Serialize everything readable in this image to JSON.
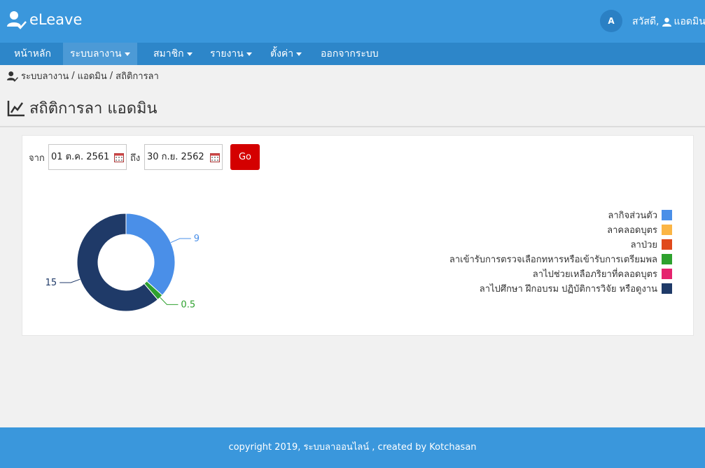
{
  "app": {
    "brand": "eLeave",
    "lang_button": "A",
    "greeting": "สวัสดี,",
    "user_name": "แอดมิน"
  },
  "menu": [
    {
      "label": "หน้าหลัก",
      "caret": false,
      "active": false
    },
    {
      "label": "ระบบลางาน",
      "caret": true,
      "active": true
    },
    {
      "label": "สมาชิก",
      "caret": true,
      "active": false
    },
    {
      "label": "รายงาน",
      "caret": true,
      "active": false
    },
    {
      "label": "ตั้งค่า",
      "caret": true,
      "active": false
    },
    {
      "label": "ออกจากระบบ",
      "caret": false,
      "active": false
    }
  ],
  "breadcrumb": [
    "ระบบลางาน",
    "แอดมิน",
    "สถิติการลา"
  ],
  "page_title": "สถิติการลา แอดมิน",
  "filter": {
    "from_label": "จาก",
    "from_value": "01 ต.ค. 2561",
    "to_label": "ถึง",
    "to_value": "30 ก.ย. 2562",
    "go_label": "Go"
  },
  "chart_data": {
    "type": "pie",
    "categories": [
      "ลากิจส่วนตัว",
      "ลาคลอดบุตร",
      "ลาป่วย",
      "ลาเข้ารับการตรวจเลือกทหารหรือเข้ารับการเตรียมพล",
      "ลาไปช่วยเหลือภริยาที่คลอดบุตร",
      "ลาไปศึกษา ฝึกอบรม ปฏิบัติการวิจัย หรือดูงาน"
    ],
    "values": [
      9,
      0,
      0,
      0.5,
      0,
      15
    ],
    "data_labels": [
      "9",
      "",
      "",
      "0.5",
      "",
      "15"
    ],
    "colors": [
      "#4a8fe8",
      "#fbb545",
      "#e0491c",
      "#2ea12e",
      "#e5236e",
      "#1f3a68"
    ],
    "legend_position": "right",
    "donut": true
  },
  "footer": {
    "text": "copyright 2019, ระบบลาออนไลน์ , created by Kotchasan"
  }
}
